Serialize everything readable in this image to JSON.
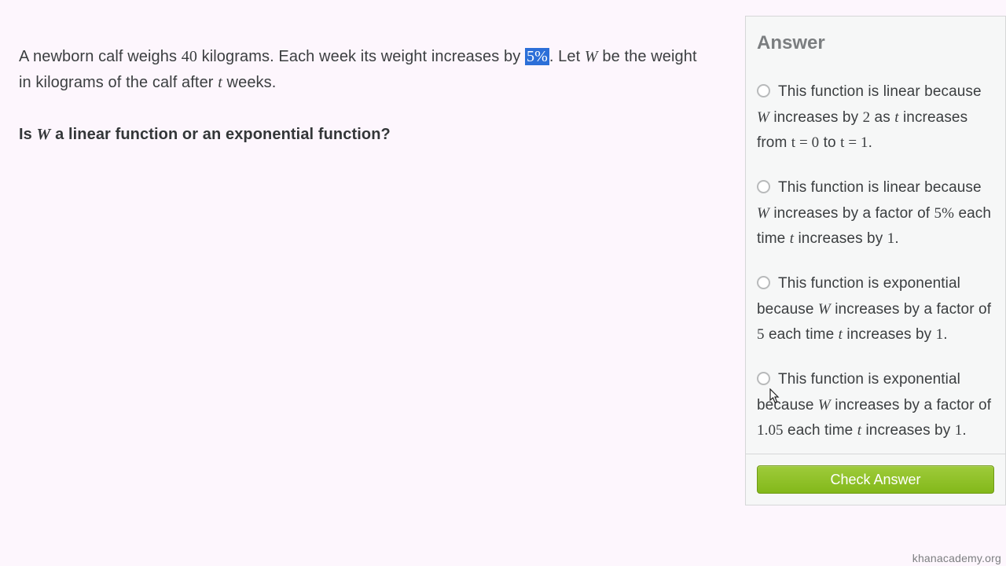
{
  "problem": {
    "part1": "A newborn calf weighs ",
    "weight": "40",
    "part2": " kilograms. Each week its weight increases by ",
    "percent": "5%",
    "part3": ". Let ",
    "varW": "W",
    "part4": " be the weight in kilograms of the calf after ",
    "vart": "t",
    "part5": " weeks."
  },
  "question": {
    "part1": "Is ",
    "varW": "W",
    "part2": " a linear function or an exponential function?"
  },
  "answer": {
    "title": "Answer",
    "choices": [
      {
        "p1": "This function is linear because ",
        "v1": "W",
        "p2": " increases by ",
        "v2": "2",
        "p3": " as ",
        "v3": "t",
        "p4": " increases from ",
        "v4": "t = 0",
        "p5": " to ",
        "v5": "t = 1",
        "p6": "."
      },
      {
        "p1": "This function is linear because ",
        "v1": "W",
        "p2": " increases by a factor of ",
        "v2": "5%",
        "p3": " each time ",
        "v3": "t",
        "p4": " increases by ",
        "v4": "1",
        "p5": ".",
        "v5": "",
        "p6": ""
      },
      {
        "p1": "This function is exponential because ",
        "v1": "W",
        "p2": " increases by a factor of ",
        "v2": "5",
        "p3": " each time ",
        "v3": "t",
        "p4": " increases by ",
        "v4": "1",
        "p5": ".",
        "v5": "",
        "p6": ""
      },
      {
        "p1": "This function is exponential because ",
        "v1": "W",
        "p2": " increases by a factor of ",
        "v2": "1.05",
        "p3": " each time ",
        "v3": "t",
        "p4": " increases by ",
        "v4": "1",
        "p5": ".",
        "v5": "",
        "p6": ""
      }
    ],
    "check_label": "Check Answer"
  },
  "watermark": "khanacademy.org"
}
